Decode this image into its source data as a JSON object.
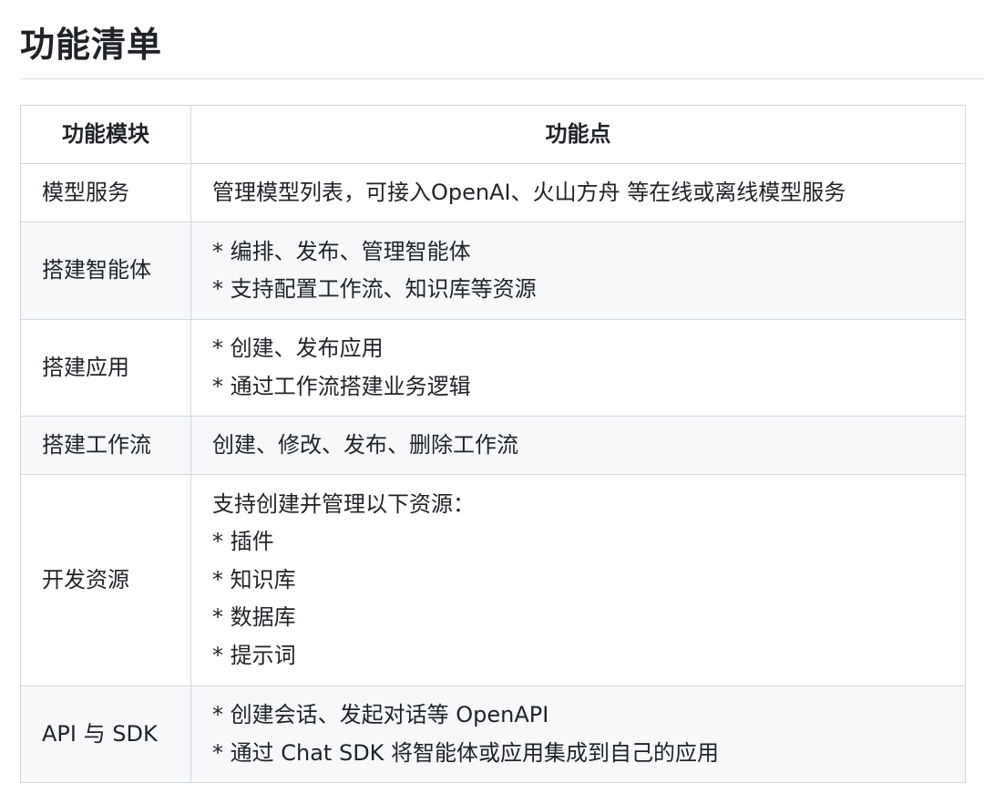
{
  "title": "功能清单",
  "table": {
    "headers": [
      "功能模块",
      "功能点"
    ],
    "rows": [
      {
        "module": "模型服务",
        "points": [
          "管理模型列表，可接入OpenAI、火山方舟 等在线或离线模型服务"
        ]
      },
      {
        "module": "搭建智能体",
        "points": [
          "* 编排、发布、管理智能体",
          "* 支持配置工作流、知识库等资源"
        ]
      },
      {
        "module": "搭建应用",
        "points": [
          "* 创建、发布应用",
          "* 通过工作流搭建业务逻辑"
        ]
      },
      {
        "module": "搭建工作流",
        "points": [
          "创建、修改、发布、删除工作流"
        ]
      },
      {
        "module": "开发资源",
        "points": [
          "支持创建并管理以下资源：",
          "* 插件",
          "* 知识库",
          "* 数据库",
          "* 提示词"
        ]
      },
      {
        "module": "API 与 SDK",
        "points": [
          "* 创建会话、发起对话等 OpenAPI",
          "* 通过 Chat SDK 将智能体或应用集成到自己的应用"
        ]
      }
    ]
  }
}
